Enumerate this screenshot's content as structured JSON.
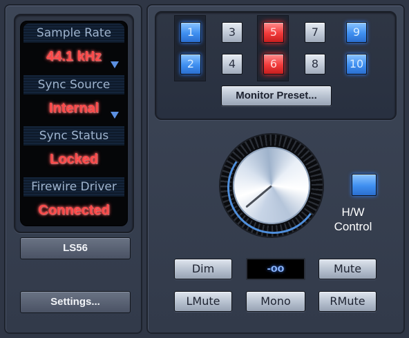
{
  "status": {
    "sample_rate_label": "Sample Rate",
    "sample_rate_value": "44.1 kHz",
    "sync_source_label": "Sync Source",
    "sync_source_value": "Internal",
    "sync_status_label": "Sync Status",
    "sync_status_value": "Locked",
    "firewire_label": "Firewire Driver",
    "firewire_value": "Connected"
  },
  "device_name": "LS56",
  "settings_label": "Settings...",
  "presets": {
    "row1": [
      {
        "label": "1",
        "state": "blue"
      },
      {
        "label": "3",
        "state": "gray"
      },
      {
        "label": "5",
        "state": "red"
      },
      {
        "label": "7",
        "state": "gray"
      },
      {
        "label": "9",
        "state": "blue"
      }
    ],
    "row2": [
      {
        "label": "2",
        "state": "blue"
      },
      {
        "label": "4",
        "state": "gray"
      },
      {
        "label": "6",
        "state": "red"
      },
      {
        "label": "8",
        "state": "gray"
      },
      {
        "label": "10",
        "state": "blue"
      }
    ],
    "monitor_preset_label": "Monitor Preset..."
  },
  "hw_control": {
    "label_line1": "H/W",
    "label_line2": "Control"
  },
  "controls": {
    "dim_label": "Dim",
    "level_readout": "-oo",
    "mute_label": "Mute",
    "lmute_label": "LMute",
    "mono_label": "Mono",
    "rmute_label": "RMute"
  },
  "colors": {
    "accent_blue": "#3f8ff0",
    "accent_red": "#f23a3a",
    "status_text": "#ff4a4a"
  }
}
